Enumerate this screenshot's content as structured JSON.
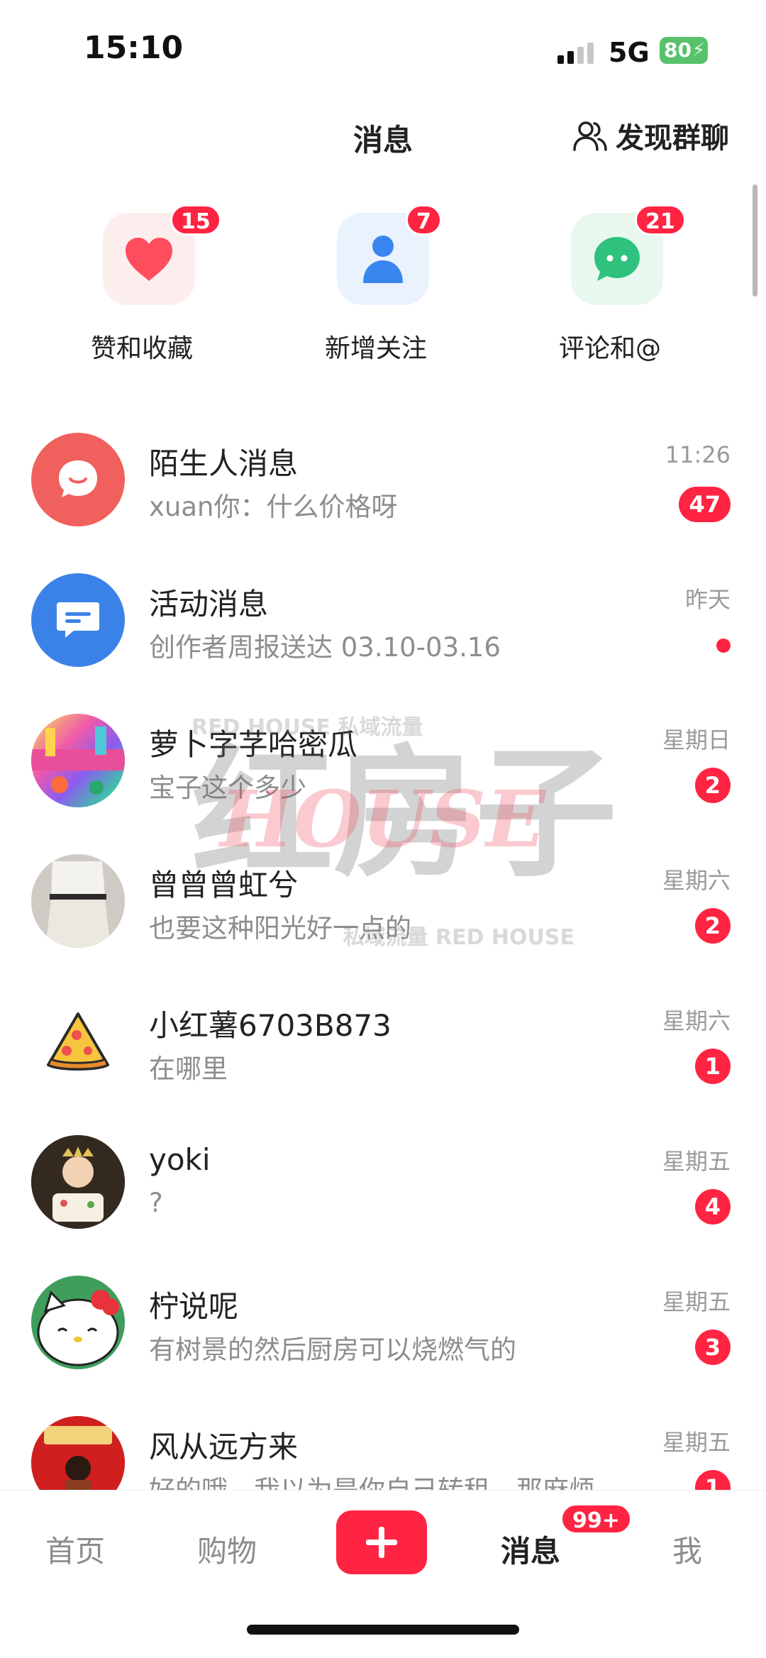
{
  "status_bar": {
    "time": "15:10",
    "network": "5G",
    "battery": "80"
  },
  "header": {
    "title": "消息",
    "discover_label": "发现群聊"
  },
  "quick_actions": [
    {
      "label": "赞和收藏",
      "badge": "15",
      "icon": "heart-icon",
      "color": "#ff4d5e"
    },
    {
      "label": "新增关注",
      "badge": "7",
      "icon": "user-icon",
      "color": "#3a86f0"
    },
    {
      "label": "评论和@",
      "badge": "21",
      "icon": "chat-bubble-icon",
      "color": "#2ec27e"
    }
  ],
  "messages": [
    {
      "name": "陌生人消息",
      "preview": "xuan你：什么价格呀",
      "time": "11:26",
      "badge": "47",
      "avatar": "stranger-chat-icon"
    },
    {
      "name": "活动消息",
      "preview": "创作者周报送达 03.10-03.16",
      "time": "昨天",
      "badge": "",
      "dot": true,
      "avatar": "activity-message-icon"
    },
    {
      "name": "萝卜字芓哈密瓜",
      "preview": "宝子这个多少",
      "time": "星期日",
      "badge": "2",
      "avatar": "colorful-avatar"
    },
    {
      "name": "曾曾曾虹兮",
      "preview": "也要这种阳光好一点的",
      "time": "星期六",
      "badge": "2",
      "avatar": "outfit-photo-avatar"
    },
    {
      "name": "小红薯6703B873",
      "preview": "在哪里",
      "time": "星期六",
      "badge": "1",
      "avatar": "pizza-avatar"
    },
    {
      "name": "yoki",
      "preview": "?",
      "time": "星期五",
      "badge": "4",
      "avatar": "birthday-photo-avatar"
    },
    {
      "name": "柠说呢",
      "preview": "有树景的然后厨房可以烧燃气的",
      "time": "星期五",
      "badge": "3",
      "avatar": "hello-kitty-avatar"
    },
    {
      "name": "风从远方来",
      "preview": "好的哦，我以为是你自己转租，那麻烦",
      "time": "星期五",
      "badge": "1",
      "avatar": "red-poster-avatar"
    }
  ],
  "watermark": {
    "line1": "RED HOUSE 私域流量",
    "main": "红房子",
    "script": "HOUSE",
    "line2": "私域流量 RED HOUSE"
  },
  "bottom_nav": {
    "home": "首页",
    "shop": "购物",
    "messages": "消息",
    "messages_badge": "99+",
    "me": "我"
  },
  "colors": {
    "accent": "#ff2442",
    "muted_text": "#8d8d8d"
  }
}
